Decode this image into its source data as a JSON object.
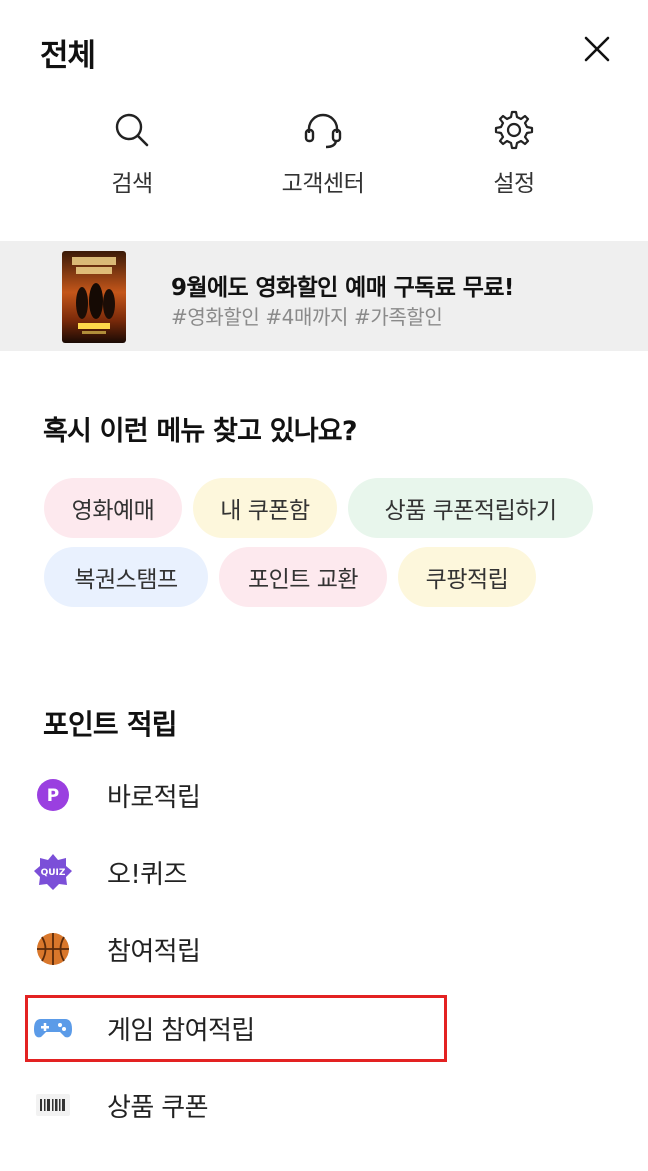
{
  "header": {
    "title": "전체",
    "close_icon": "close-icon"
  },
  "quick_actions": [
    {
      "label": "검색",
      "icon": "search-icon"
    },
    {
      "label": "고객센터",
      "icon": "headset-icon"
    },
    {
      "label": "설정",
      "icon": "gear-icon"
    }
  ],
  "banner": {
    "title": "9월에도 영화할인 예매 구독료 무료!",
    "tags": "#영화할인 #4매까지 #가족할인"
  },
  "suggestions": {
    "title": "혹시 이런 메뉴 찾고 있나요?",
    "chips": [
      {
        "label": "영화예매",
        "color": "#fde9ee"
      },
      {
        "label": "내 쿠폰함",
        "color": "#fdf7dc"
      },
      {
        "label": "상품 쿠폰적립하기",
        "color": "#e8f6ec"
      },
      {
        "label": "복권스탬프",
        "color": "#e9f1fe"
      },
      {
        "label": "포인트 교환",
        "color": "#fde9ee"
      },
      {
        "label": "쿠팡적립",
        "color": "#fdf7dc"
      }
    ]
  },
  "point_section": {
    "title": "포인트 적립",
    "items": [
      {
        "label": "바로적립",
        "icon": "point-p-icon"
      },
      {
        "label": "오!퀴즈",
        "icon": "quiz-icon"
      },
      {
        "label": "참여적립",
        "icon": "basketball-icon"
      },
      {
        "label": "게임 참여적립",
        "icon": "gamepad-icon"
      },
      {
        "label": "상품 쿠폰",
        "icon": "barcode-icon"
      }
    ]
  },
  "colors": {
    "accent_purple": "#9a3fe0",
    "highlight_red": "#e32222",
    "banner_bg": "#efefef"
  }
}
